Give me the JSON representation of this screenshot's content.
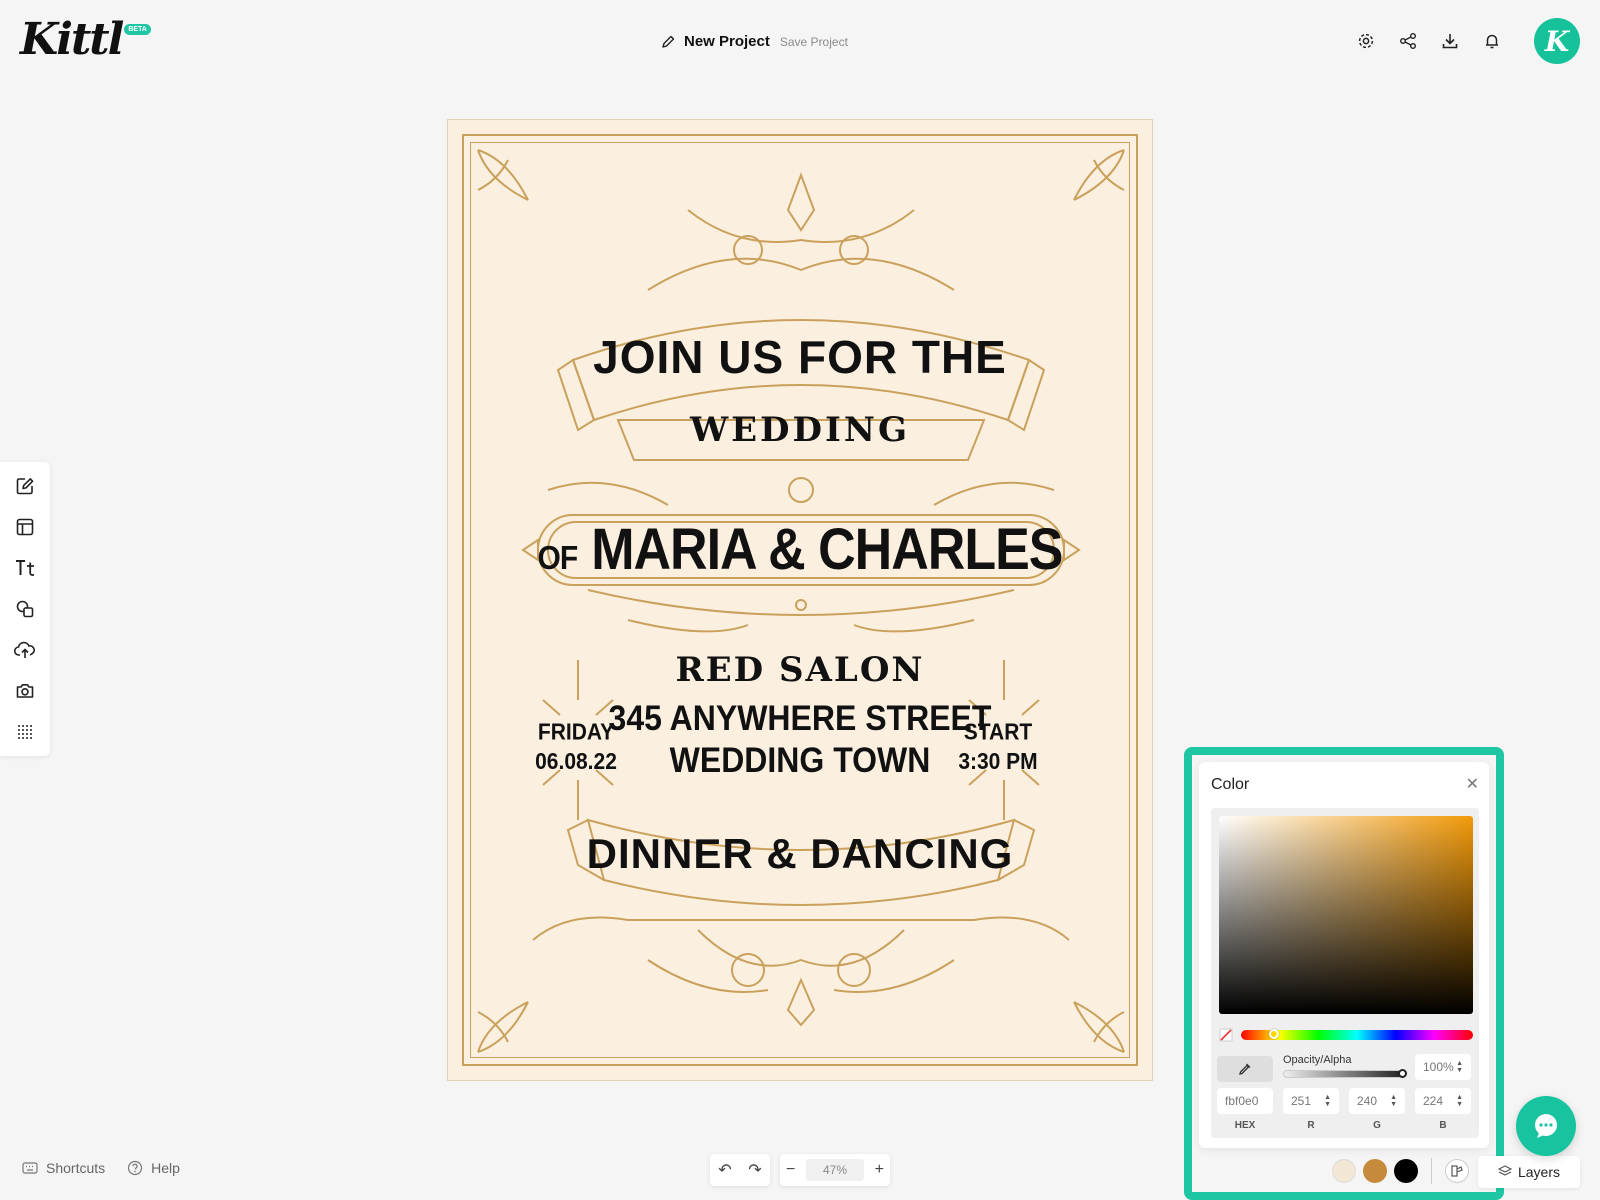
{
  "header": {
    "logo": "Kittl",
    "beta": "BETA",
    "project_name": "New Project",
    "save_label": "Save Project",
    "avatar_letter": "K"
  },
  "poster": {
    "line1": "JOIN US FOR THE",
    "line2": "WEDDING",
    "of": "OF",
    "names": "MARIA & CHARLES",
    "venue": "RED SALON",
    "street": "345 ANYWHERE STREET",
    "town": "WEDDING TOWN",
    "day": "FRIDAY",
    "date": "06.08.22",
    "start_label": "START",
    "start_time": "3:30 PM",
    "dinner": "DINNER & DANCING",
    "background": "#fbf0e0",
    "ornament_color": "#c9a15c"
  },
  "color_panel": {
    "title": "Color",
    "opacity_label": "Opacity/Alpha",
    "opacity": "100%",
    "hex": "fbf0e0",
    "r": "251",
    "g": "240",
    "b": "224",
    "hex_label": "HEX",
    "r_label": "R",
    "g_label": "G",
    "b_label": "B"
  },
  "swatches": [
    "#f2e6d4",
    "#c68a3c",
    "#000000"
  ],
  "layers_label": "Layers",
  "bottom": {
    "shortcuts": "Shortcuts",
    "help": "Help",
    "zoom": "47%"
  },
  "colors": {
    "accent": "#1ec6a3"
  }
}
